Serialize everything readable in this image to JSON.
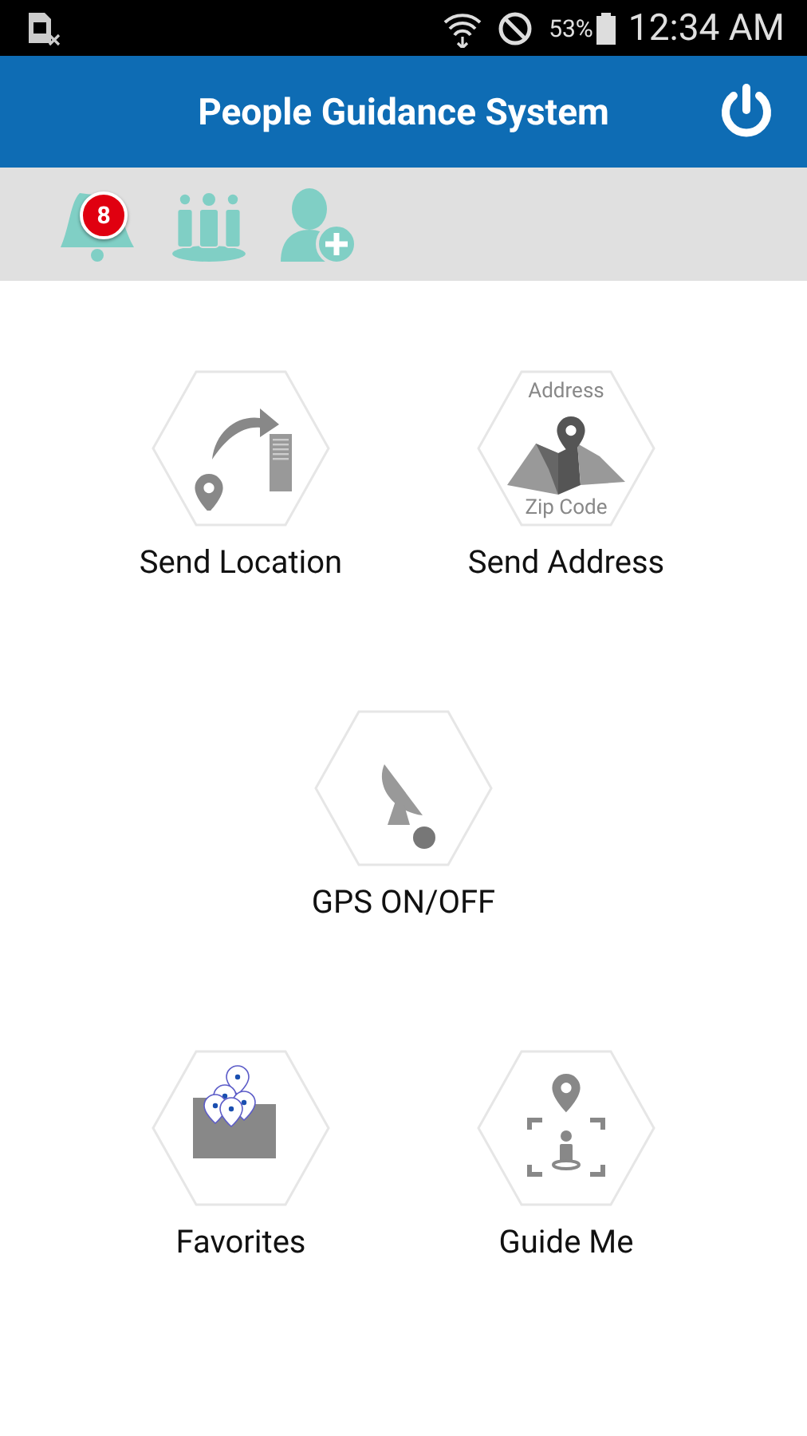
{
  "status_bar": {
    "battery_text": "53%",
    "time": "12:34 AM"
  },
  "header": {
    "title": "People Guidance System"
  },
  "toolbar": {
    "notification_count": "8"
  },
  "rows": [
    {
      "tiles": [
        {
          "kind": "send-location",
          "label": "Send Location"
        },
        {
          "kind": "send-address",
          "label": "Send Address",
          "top_text": "Address",
          "bottom_text": "Zip Code"
        }
      ]
    },
    {
      "tiles": [
        {
          "kind": "gps",
          "label": "GPS ON/OFF"
        }
      ]
    },
    {
      "tiles": [
        {
          "kind": "favorites",
          "label": "Favorites"
        },
        {
          "kind": "guide-me",
          "label": "Guide Me"
        }
      ]
    }
  ]
}
